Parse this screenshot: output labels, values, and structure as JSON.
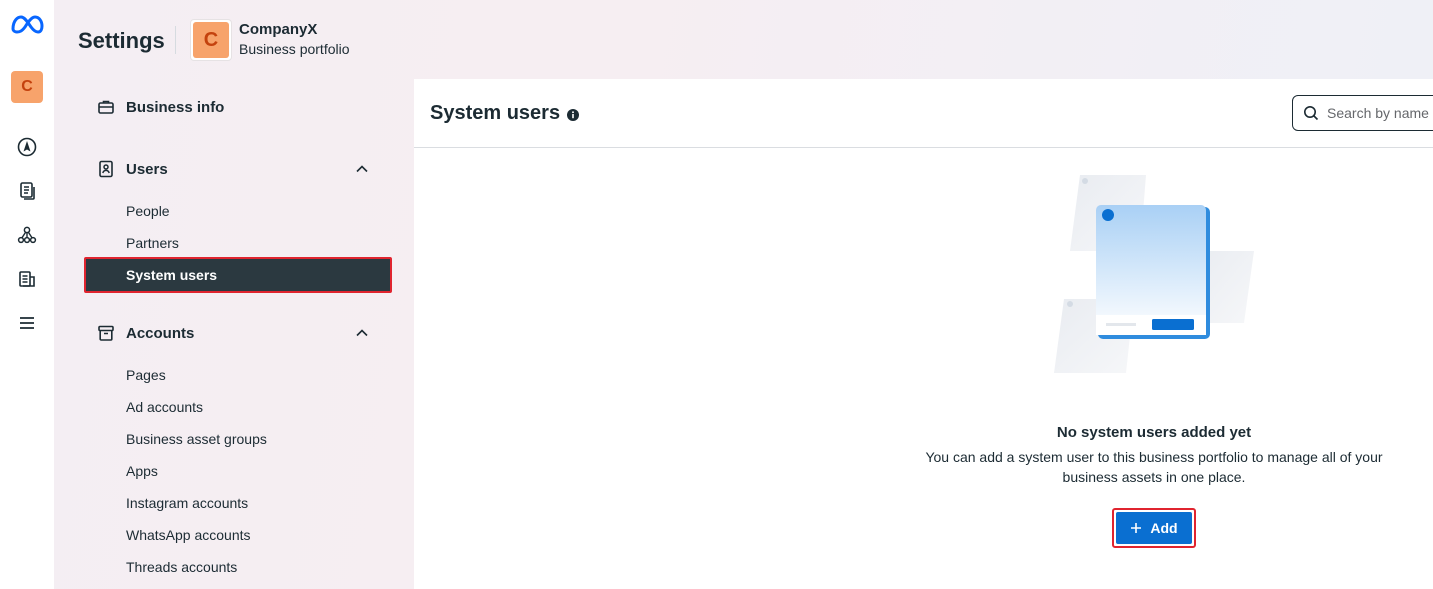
{
  "header": {
    "title": "Settings",
    "portfolio": {
      "initial": "C",
      "name": "CompanyX",
      "subtitle": "Business portfolio"
    }
  },
  "rail": {
    "avatar_initial": "C",
    "icons": [
      "meta-logo-icon",
      "compass-icon",
      "documents-icon",
      "network-icon",
      "billing-icon",
      "menu-icon"
    ]
  },
  "sidebar": {
    "business_info": "Business info",
    "users": {
      "label": "Users",
      "items": [
        "People",
        "Partners",
        "System users"
      ]
    },
    "accounts": {
      "label": "Accounts",
      "items": [
        "Pages",
        "Ad accounts",
        "Business asset groups",
        "Apps",
        "Instagram accounts",
        "WhatsApp accounts",
        "Threads accounts"
      ]
    },
    "active_item": "System users"
  },
  "main": {
    "title": "System users",
    "search_placeholder": "Search by name",
    "empty_title": "No system users added yet",
    "empty_desc": "You can add a system user to this business portfolio to manage all of your business assets in one place.",
    "add_label": "Add"
  },
  "colors": {
    "accent": "#0a6fd1",
    "active_bg": "#2b3940",
    "highlight": "#e0242f",
    "avatar": "#f7a36b"
  }
}
